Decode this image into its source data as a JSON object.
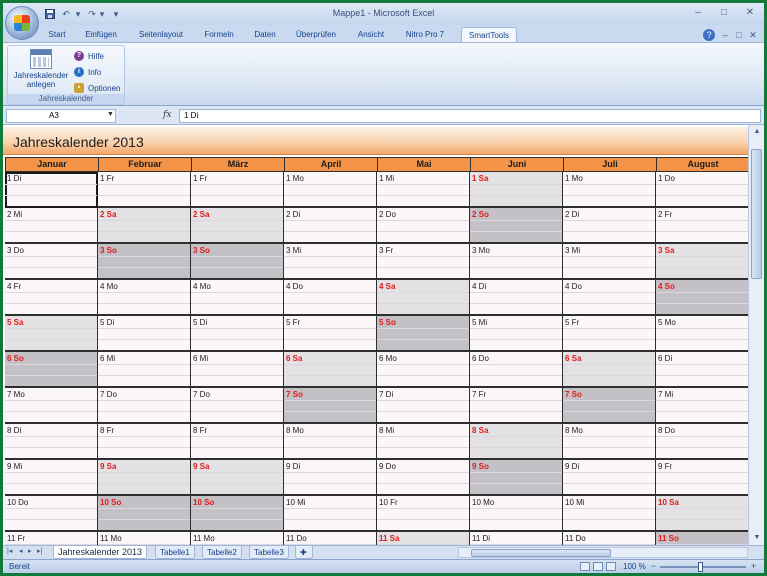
{
  "window": {
    "title": "Mappe1 - Microsoft Excel",
    "controls": {
      "minimize": "–",
      "maximize": "□",
      "close": "✕"
    },
    "inner_controls": {
      "help": "?",
      "minimize": "–",
      "restore": "□",
      "close": "✕"
    }
  },
  "quick_access": {
    "save_icon": "save-icon",
    "undo": "↶",
    "redo": "↷",
    "customize": "▾"
  },
  "tabs": [
    "Start",
    "Einfügen",
    "Seitenlayout",
    "Formeln",
    "Daten",
    "Überprüfen",
    "Ansicht",
    "Nitro Pro 7",
    "SmartTools"
  ],
  "active_tab": "SmartTools",
  "ribbon": {
    "big_button": {
      "line1": "Jahreskalender",
      "line2": "anlegen"
    },
    "small_buttons": [
      "Hilfe",
      "Info",
      "Optionen"
    ],
    "group_label": "Jahreskalender"
  },
  "formula_bar": {
    "name_box": "A3",
    "fx": "fx",
    "value": "1 Di"
  },
  "sheet": {
    "title": "Jahreskalender 2013",
    "months": [
      "Januar",
      "Februar",
      "März",
      "April",
      "Mai",
      "Juni",
      "Juli",
      "August"
    ],
    "days": [
      [
        "1 Di",
        "2 Mi",
        "3 Do",
        "4 Fr",
        "5 Sa",
        "6 So",
        "7 Mo",
        "8 Di",
        "9 Mi",
        "10 Do",
        "11 Fr"
      ],
      [
        "1 Fr",
        "2 Sa",
        "3 So",
        "4 Mo",
        "5 Di",
        "6 Mi",
        "7 Do",
        "8 Fr",
        "9 Sa",
        "10 So",
        "11 Mo"
      ],
      [
        "1 Fr",
        "2 Sa",
        "3 So",
        "4 Mo",
        "5 Di",
        "6 Mi",
        "7 Do",
        "8 Fr",
        "9 Sa",
        "10 So",
        "11 Mo"
      ],
      [
        "1 Mo",
        "2 Di",
        "3 Mi",
        "4 Do",
        "5 Fr",
        "6 Sa",
        "7 So",
        "8 Mo",
        "9 Di",
        "10 Mi",
        "11 Do"
      ],
      [
        "1 Mi",
        "2 Do",
        "3 Fr",
        "4 Sa",
        "5 So",
        "6 Mo",
        "7 Di",
        "8 Mi",
        "9 Do",
        "10 Fr",
        "11 Sa"
      ],
      [
        "1 Sa",
        "2 So",
        "3 Mo",
        "4 Di",
        "5 Mi",
        "6 Do",
        "7 Fr",
        "8 Sa",
        "9 So",
        "10 Mo",
        "11 Di"
      ],
      [
        "1 Mo",
        "2 Di",
        "3 Mi",
        "4 Do",
        "5 Fr",
        "6 Sa",
        "7 So",
        "8 Mo",
        "9 Di",
        "10 Mi",
        "11 Do"
      ],
      [
        "1 Do",
        "2 Fr",
        "3 Sa",
        "4 So",
        "5 Mo",
        "6 Di",
        "7 Mi",
        "8 Do",
        "9 Fr",
        "10 Sa",
        "11 So"
      ]
    ]
  },
  "sheet_tabs": [
    "Jahreskalender 2013",
    "Tabelle1",
    "Tabelle2",
    "Tabelle3"
  ],
  "sheet_nav": [
    "|◂",
    "◂",
    "▸",
    "▸|"
  ],
  "status": {
    "text": "Bereit",
    "zoom": "100 %",
    "zoom_minus": "−",
    "zoom_plus": "+"
  },
  "colors": {
    "accent": "#f39448",
    "weekend_text": "#e21b1b",
    "saturday_bg": "#e3e1e4",
    "sunday_bg": "#c3c1c5"
  }
}
